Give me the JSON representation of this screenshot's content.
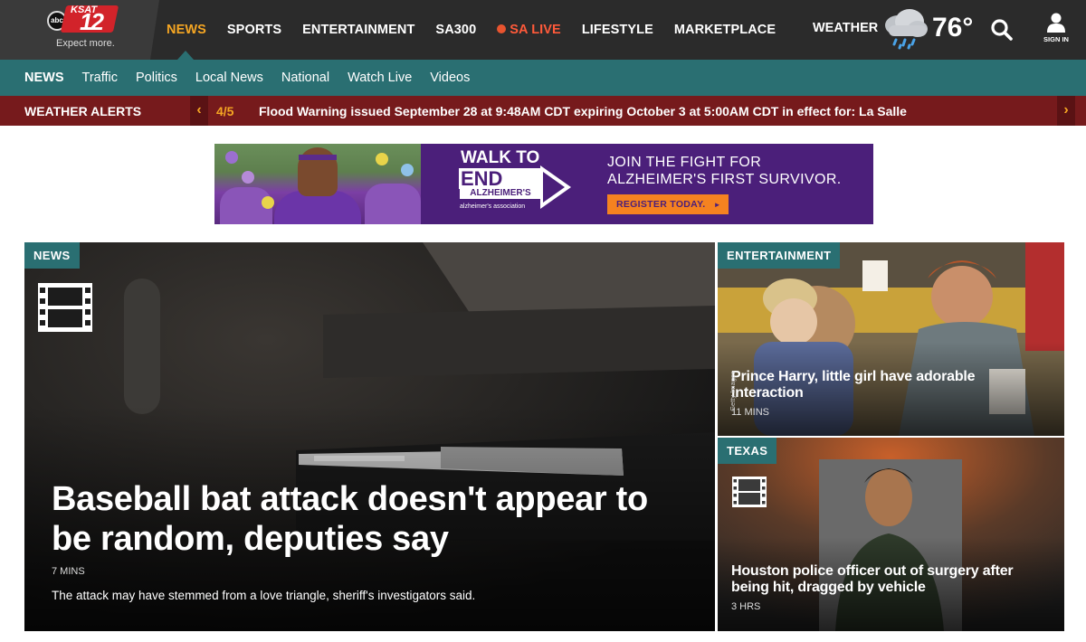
{
  "brand": {
    "network": "abc",
    "station": "KSAT",
    "number": "12",
    "tagline": "Expect more."
  },
  "topnav": {
    "items": [
      {
        "label": "NEWS",
        "active": true
      },
      {
        "label": "SPORTS"
      },
      {
        "label": "ENTERTAINMENT"
      },
      {
        "label": "SA300"
      },
      {
        "label": "SA LIVE",
        "live": true
      },
      {
        "label": "LIFESTYLE"
      },
      {
        "label": "MARKETPLACE"
      }
    ],
    "weather_label": "WEATHER",
    "weather_icon": "rain-cloud-icon",
    "temperature": "76°",
    "search_icon": "search-icon",
    "signin_label": "SIGN IN"
  },
  "subnav": {
    "section": "NEWS",
    "items": [
      "Traffic",
      "Politics",
      "Local News",
      "National",
      "Watch Live",
      "Videos"
    ]
  },
  "alerts": {
    "title": "WEATHER ALERTS",
    "count": "4/5",
    "text": "Flood Warning issued September 28 at 9:48AM CDT expiring October 3 at 5:00AM CDT in effect for: La Salle",
    "prev_glyph": "‹",
    "next_glyph": "›"
  },
  "ad": {
    "walk": "WALK TO",
    "end": "END",
    "alzheimers": "ALZHEIMER'S",
    "association": "alzheimer's association",
    "headline_1": "JOIN THE FIGHT FOR",
    "headline_2": "ALZHEIMER'S FIRST SURVIVOR.",
    "cta": "REGISTER TODAY.",
    "cta_arrow": "►"
  },
  "stories": {
    "main": {
      "tag": "NEWS",
      "headline": "Baseball bat attack doesn't appear to be random, deputies say",
      "time": "7 MINS",
      "summary": "The attack may have stemmed from a love triangle, sheriff's investigators said.",
      "icon": "film-icon"
    },
    "entertainment": {
      "tag": "ENTERTAINMENT",
      "headline": "Prince Harry, little girl have adorable interaction",
      "time": "11 MINS",
      "credit": "Getty Images"
    },
    "texas": {
      "tag": "TEXAS",
      "headline": "Houston police officer out of surgery after being hit, dragged by vehicle",
      "time": "3 HRS",
      "icon": "film-icon"
    }
  },
  "colors": {
    "topbar": "#2b2b2b",
    "teal": "#2a6f72",
    "alert": "#761a1c",
    "accent": "#f5a623",
    "live": "#e8542f",
    "ad_purple": "#4b1f7a",
    "ad_orange": "#f58220"
  }
}
